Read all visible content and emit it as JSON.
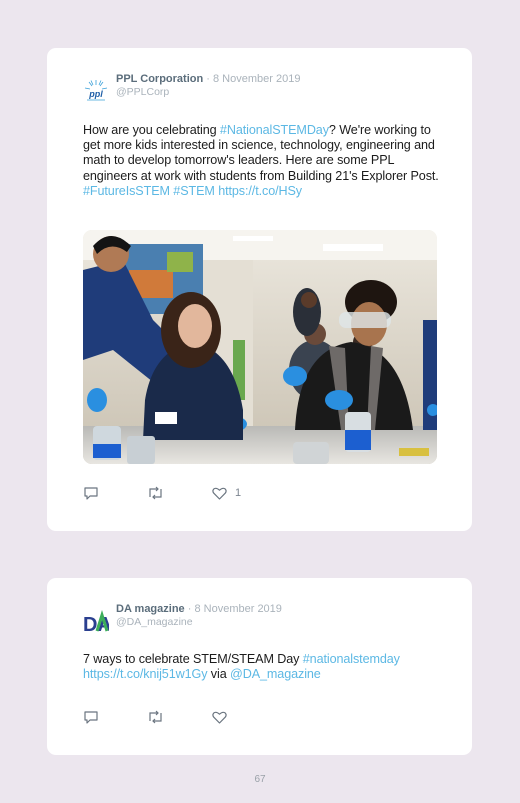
{
  "tweets": [
    {
      "author": "PPL Corporation",
      "separator": "·",
      "date": "8 November 2019",
      "handle": "@PPLCorp",
      "avatar_text": "ppl",
      "text_segments": [
        {
          "text": "How are you celebrating ",
          "type": "text"
        },
        {
          "text": "#NationalSTEMDay",
          "type": "tag"
        },
        {
          "text": "? We're working to get more kids interested in science, technology, engineering and math to develop tomorrow's leaders. Here are some PPL engineers at work with students from Building 21's Explorer Post. ",
          "type": "text"
        },
        {
          "text": "#FutureIsSTEM",
          "type": "tag"
        },
        {
          "text": " ",
          "type": "text"
        },
        {
          "text": "#STEM",
          "type": "tag"
        },
        {
          "text": " ",
          "type": "text"
        },
        {
          "text": "https://t.co/HSy",
          "type": "tag"
        }
      ],
      "like_count": "1"
    },
    {
      "author": "DA magazine",
      "separator": "·",
      "date": "8 November 2019",
      "handle": "@DA_magazine",
      "avatar_text": "DA",
      "text_segments": [
        {
          "text": "7 ways to celebrate STEM/STEAM Day ",
          "type": "text"
        },
        {
          "text": "#nationalstemday",
          "type": "tag"
        },
        {
          "text": " ",
          "type": "text"
        },
        {
          "text": "https://t.co/knij51w1Gy",
          "type": "tag"
        },
        {
          "text": " via ",
          "type": "text"
        },
        {
          "text": "@DA_magazine",
          "type": "tag"
        }
      ],
      "like_count": ""
    }
  ],
  "icons": [
    "reply-icon",
    "retweet-icon",
    "like-icon"
  ],
  "colors": {
    "background": "#ece6ee",
    "card": "#ffffff",
    "link": "#5cb8e4",
    "author": "#5b6d7b"
  },
  "page_number": "67"
}
